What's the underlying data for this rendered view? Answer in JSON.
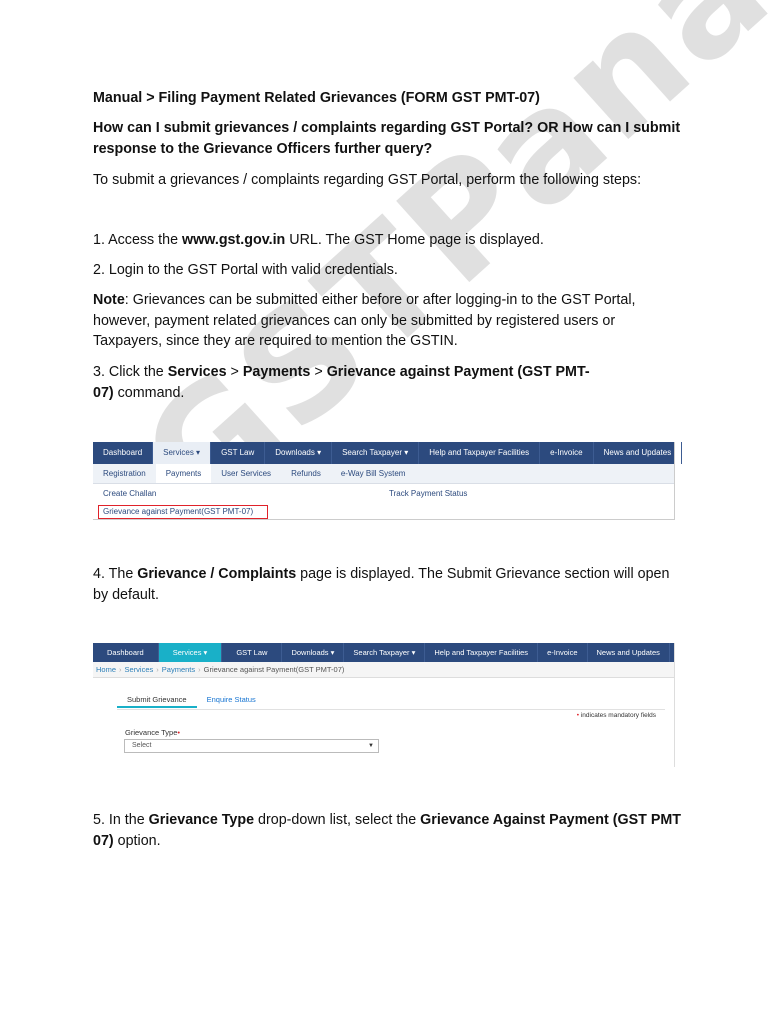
{
  "heading": "Manual > Filing Payment Related Grievances (FORM GST PMT-07)",
  "question": "How can I submit grievances / complaints regarding GST Portal? OR How can I submit response to the Grievance Officers further query?",
  "intro": "To submit a grievances / complaints regarding GST Portal, perform the following steps:",
  "step1": {
    "pre": "1. Access the ",
    "url": "www.gst.gov.in",
    "post": " URL. The GST Home page is displayed."
  },
  "step2": "2. Login to the GST Portal with valid credentials.",
  "note": {
    "label": "Note",
    "text": ": Grievances can be submitted either before or after logging-in to the GST Portal, however, payment related grievances can only be submitted by registered users or Taxpayers, since they are required to mention the GSTIN."
  },
  "step3": {
    "pre": "3. Click the ",
    "b1": "Services",
    "sep1": " > ",
    "b2": "Payments",
    "sep2": " > ",
    "b3": "Grievance against Payment (GST PMT-07)",
    "post": " command."
  },
  "step4": {
    "pre": "4. The ",
    "b1": "Grievance / Complaints",
    "post": " page is displayed. The Submit Grievance section will open by default."
  },
  "step5": {
    "pre": "5. In the ",
    "b1": "Grievance Type",
    "mid": " drop-down list, select the ",
    "b2": "Grievance Against Payment (GST PMT 07)",
    "post": " option."
  },
  "watermark": "GSTPanacea",
  "shot1": {
    "nav": [
      "Dashboard",
      "Services ▾",
      "GST Law",
      "Downloads ▾",
      "Search Taxpayer ▾",
      "Help and Taxpayer Facilities",
      "e-Invoice",
      "News and Updates"
    ],
    "subnav": [
      "Registration",
      "Payments",
      "User Services",
      "Refunds",
      "e-Way Bill System"
    ],
    "create_challan": "Create Challan",
    "track_payment": "Track Payment Status",
    "grievance_link": "Grievance against Payment(GST PMT-07)"
  },
  "shot2": {
    "nav": [
      "Dashboard",
      "Services ▾",
      "GST Law",
      "Downloads ▾",
      "Search Taxpayer ▾",
      "Help and Taxpayer Facilities",
      "e-Invoice",
      "News and Updates"
    ],
    "breadcrumb": [
      "Home",
      "Services",
      "Payments"
    ],
    "breadcrumb_current": "Grievance against Payment(GST PMT-07)",
    "tab_submit": "Submit Grievance",
    "tab_enquire": "Enquire Status",
    "mandatory_star": "•",
    "mandatory_text": " indicates mandatory fields",
    "field_label": "Grievance Type",
    "field_star": "•",
    "select_value": "Select"
  },
  "colors": {
    "nav_bg": "#2c4a7e",
    "active_tab": "#19b0c8",
    "highlight": "#e0222a"
  }
}
